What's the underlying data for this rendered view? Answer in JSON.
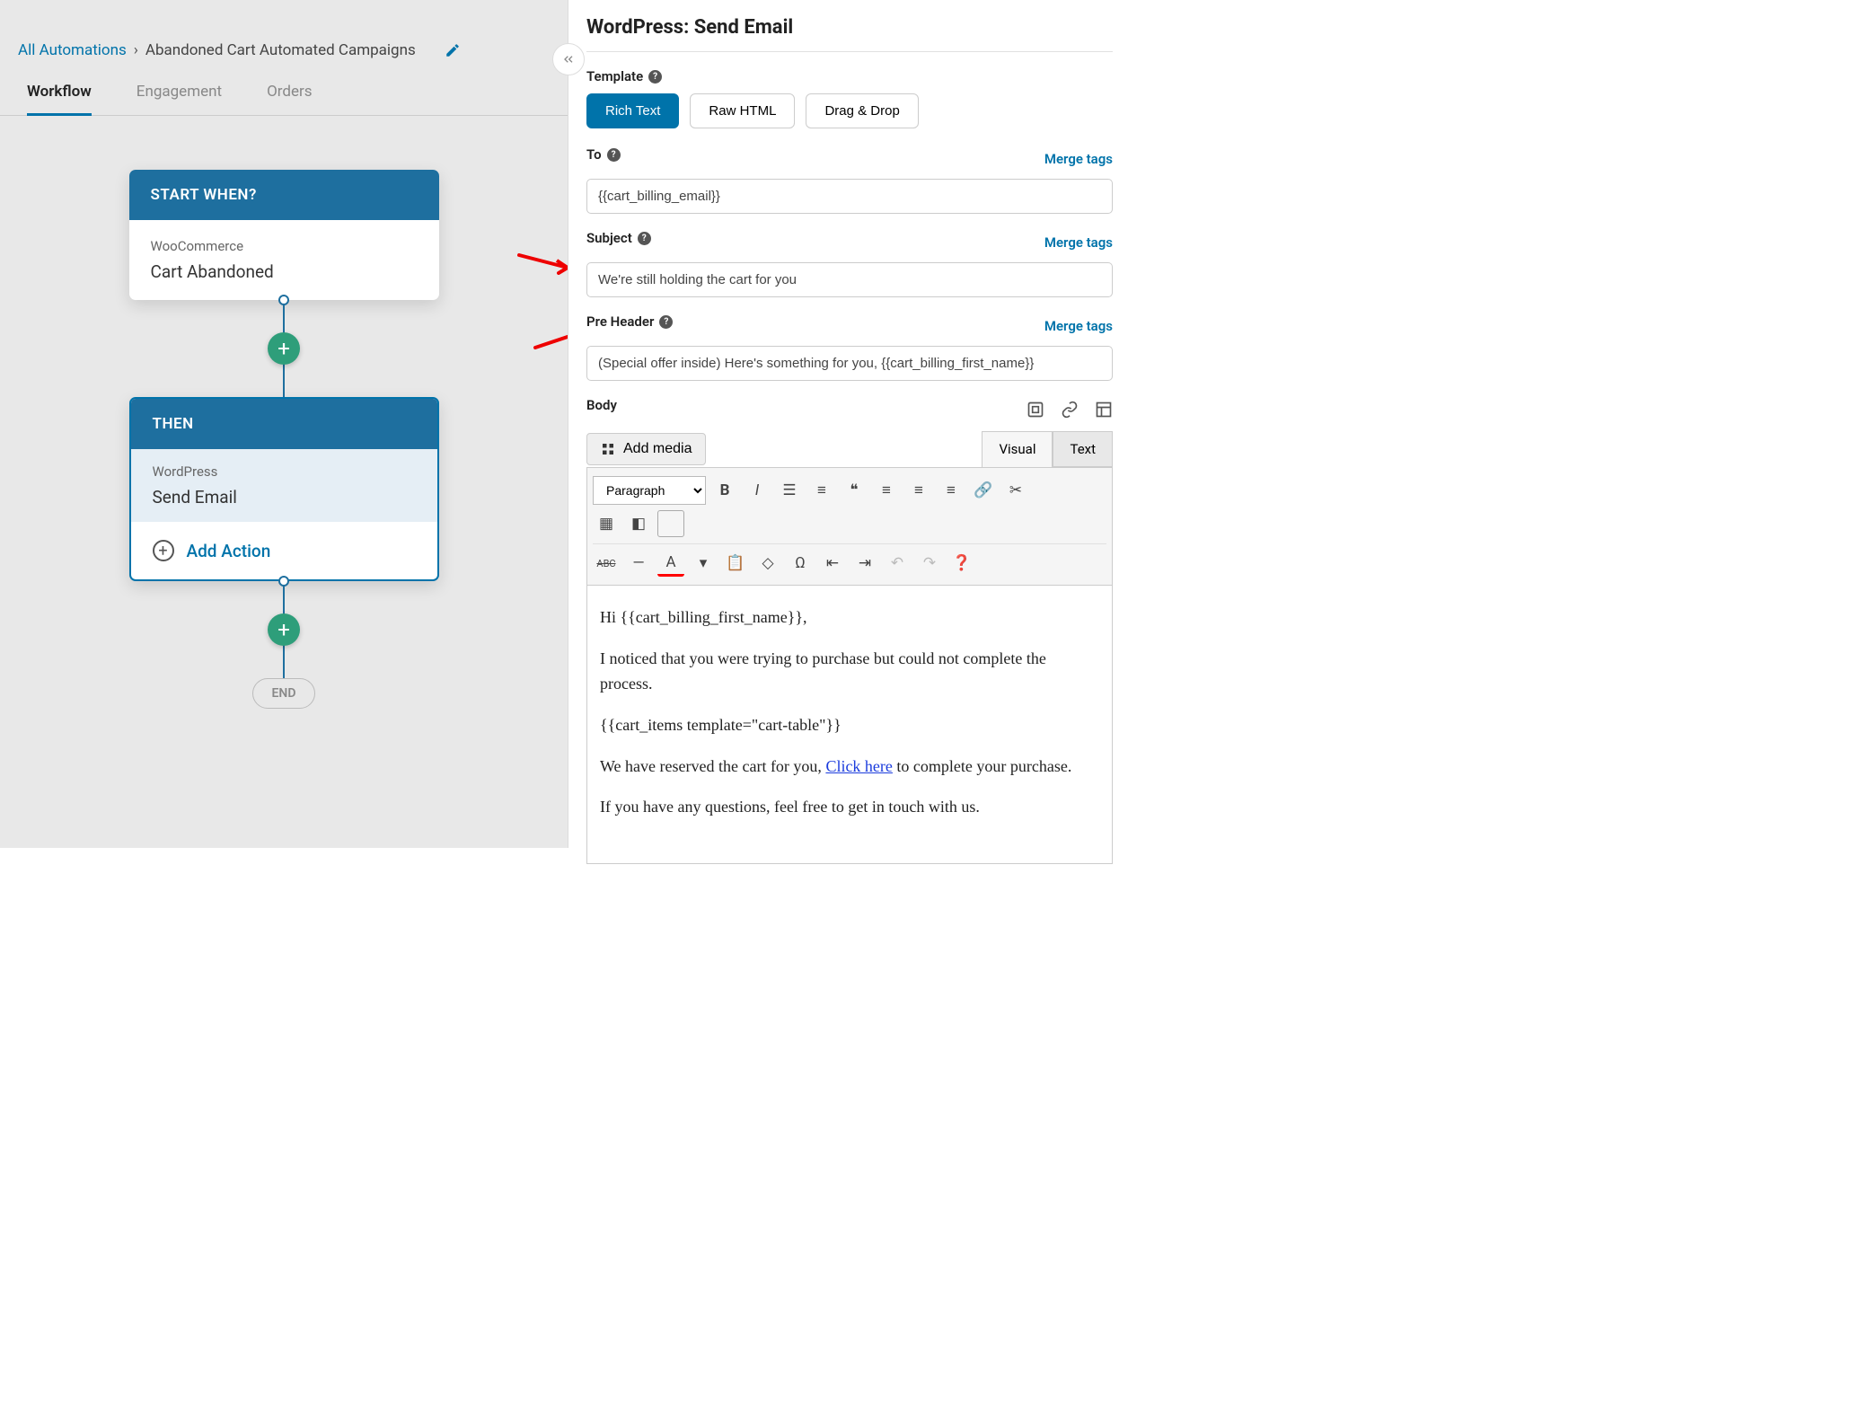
{
  "breadcrumb": {
    "home": "All Automations",
    "current": "Abandoned Cart Automated Campaigns"
  },
  "tabs": [
    "Workflow",
    "Engagement",
    "Orders"
  ],
  "workflow": {
    "start_header": "START WHEN?",
    "start_small": "WooCommerce",
    "start_big": "Cart Abandoned",
    "then_header": "THEN",
    "then_small": "WordPress",
    "then_big": "Send Email",
    "add_action": "Add Action",
    "end": "END"
  },
  "panel": {
    "title": "WordPress: Send Email",
    "template_label": "Template",
    "template_options": [
      "Rich Text",
      "Raw HTML",
      "Drag & Drop"
    ],
    "to_label": "To",
    "to_value": "{{cart_billing_email}}",
    "subject_label": "Subject",
    "subject_value": "We're still holding the cart for you",
    "preheader_label": "Pre Header",
    "preheader_value": "(Special offer inside) Here's something for you, {{cart_billing_first_name}}",
    "body_label": "Body",
    "merge_tags": "Merge tags",
    "add_media": "Add media",
    "editor_tabs": [
      "Visual",
      "Text"
    ],
    "format_select": "Paragraph",
    "body_html": {
      "p1": "Hi {{cart_billing_first_name}},",
      "p2": "I noticed that you were trying to purchase but could not complete the process.",
      "p3": "{{cart_items template=\"cart-table\"}}",
      "p4a": "We have reserved the cart for you, ",
      "p4link": "Click here",
      "p4b": " to complete your purchase.",
      "p5": "If you have any questions, feel free to get in touch with us."
    }
  }
}
